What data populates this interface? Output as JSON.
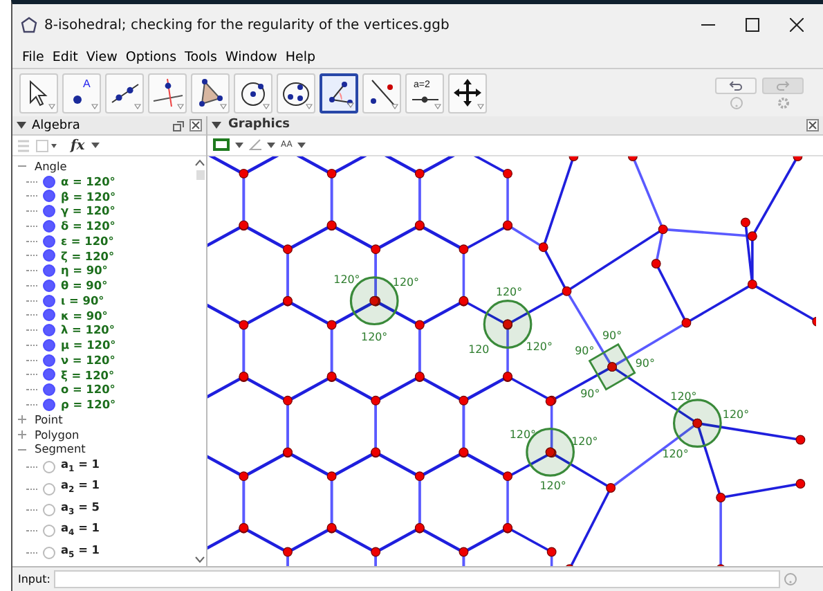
{
  "window": {
    "title": "8-isohedral; checking for the regularity of the vertices.ggb"
  },
  "menu": [
    "File",
    "Edit",
    "View",
    "Options",
    "Tools",
    "Window",
    "Help"
  ],
  "toolbar": {
    "tools": [
      {
        "kind": "move",
        "selected": false
      },
      {
        "kind": "point",
        "glyph": "A",
        "selected": false
      },
      {
        "kind": "line",
        "selected": false
      },
      {
        "kind": "perpendicular",
        "selected": false
      },
      {
        "kind": "polygon",
        "selected": false
      },
      {
        "kind": "circle",
        "selected": false
      },
      {
        "kind": "conic",
        "selected": false
      },
      {
        "kind": "angle",
        "selected": true
      },
      {
        "kind": "reflect",
        "selected": false
      },
      {
        "kind": "slider",
        "glyph": "a=2",
        "selected": false
      },
      {
        "kind": "move-view",
        "selected": false
      }
    ],
    "history": [
      {
        "kind": "undo",
        "disabled": false
      },
      {
        "kind": "redo",
        "disabled": true
      }
    ]
  },
  "algebra": {
    "title": "Algebra",
    "style_glyph": "fx",
    "groups": [
      {
        "label": "Angle",
        "expanded": true,
        "children": [
          {
            "label": "α = 120°",
            "visible": true
          },
          {
            "label": "β = 120°",
            "visible": true
          },
          {
            "label": "γ = 120°",
            "visible": true
          },
          {
            "label": "δ = 120°",
            "visible": true
          },
          {
            "label": "ε = 120°",
            "visible": true
          },
          {
            "label": "ζ = 120°",
            "visible": true
          },
          {
            "label": "η = 90°",
            "visible": true
          },
          {
            "label": "θ = 90°",
            "visible": true
          },
          {
            "label": "ι = 90°",
            "visible": true
          },
          {
            "label": "κ = 90°",
            "visible": true
          },
          {
            "label": "λ = 120°",
            "visible": true
          },
          {
            "label": "μ = 120°",
            "visible": true
          },
          {
            "label": "ν = 120°",
            "visible": true
          },
          {
            "label": "ξ = 120°",
            "visible": true
          },
          {
            "label": "ο = 120°",
            "visible": true
          },
          {
            "label": "ρ = 120°",
            "visible": true
          }
        ]
      },
      {
        "label": "Point",
        "expanded": false
      },
      {
        "label": "Polygon",
        "expanded": false
      },
      {
        "label": "Segment",
        "expanded": true,
        "children": [
          {
            "label": "a$_{1}$ = 1",
            "visible": false
          },
          {
            "label": "a$_{2}$ = 1",
            "visible": false
          },
          {
            "label": "a$_{3}$ = 5",
            "visible": false
          },
          {
            "label": "a$_{4}$ = 1",
            "visible": false
          },
          {
            "label": "a$_{5}$ = 1",
            "visible": false
          }
        ]
      }
    ]
  },
  "graphics": {
    "title": "Graphics",
    "style_glyph": "AA",
    "angle_markers": [
      {
        "kind": "circle",
        "labels": [
          "120°",
          "120°",
          "120°"
        ]
      },
      {
        "kind": "circle",
        "labels": [
          "120°",
          "120",
          "120°"
        ]
      },
      {
        "kind": "right",
        "labels": [
          "90°",
          "90°",
          "90°",
          "90°"
        ]
      },
      {
        "kind": "circle",
        "labels": [
          "120°",
          "120°",
          "120°"
        ]
      },
      {
        "kind": "circle",
        "labels": [
          "120°",
          "120°",
          "120°"
        ]
      }
    ]
  },
  "input": {
    "label": "Input:"
  }
}
